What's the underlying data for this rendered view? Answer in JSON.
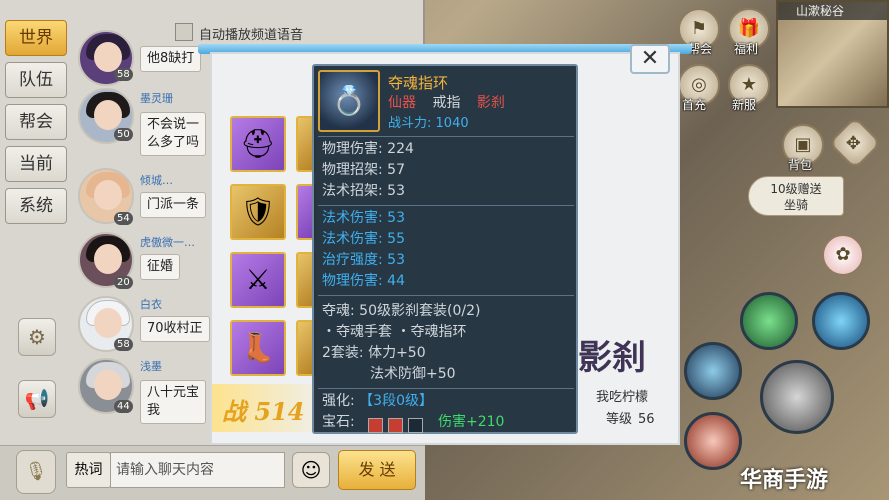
{
  "chat": {
    "tabs": [
      "世界",
      "队伍",
      "帮会",
      "当前",
      "系统"
    ],
    "auto_voice_label": "自动播放频道语音",
    "messages": [
      {
        "name": "",
        "level": "58",
        "text": "他8缺打"
      },
      {
        "name": "墨灵珊",
        "level": "50",
        "text": "不会说一\n么多了吗"
      },
      {
        "name": "倾城…",
        "level": "54",
        "text": "门派一条"
      },
      {
        "name": "虎傲微一…",
        "level": "20",
        "text": "征婚"
      },
      {
        "name": "白衣",
        "level": "58",
        "text": "70收村正"
      },
      {
        "name": "浅墨",
        "level": "44",
        "text": "八十元宝\n我"
      }
    ],
    "hot_label": "热词",
    "input_placeholder": "请输入聊天内容",
    "send_label": "发 送"
  },
  "equip_window": {
    "close_symbol": "✕",
    "power_prefix": "战",
    "power_value": "514",
    "calligraphy": "影刹",
    "player_name": "我吃柠檬",
    "level_label": "等级",
    "level_value": "56"
  },
  "tooltip": {
    "name": "夺魂指环",
    "grade": "仙器",
    "slot_type": "戒指",
    "set_school": "影刹",
    "power_label": "战斗力:",
    "power_value": "1040",
    "base_stats": [
      {
        "label": "物理伤害:",
        "value": "224"
      },
      {
        "label": "物理招架:",
        "value": "57"
      },
      {
        "label": "法术招架:",
        "value": "53"
      }
    ],
    "extra_stats": [
      {
        "label": "法术伤害:",
        "value": "53"
      },
      {
        "label": "法术伤害:",
        "value": "55"
      },
      {
        "label": "治疗强度:",
        "value": "53"
      },
      {
        "label": "物理伤害:",
        "value": "44"
      }
    ],
    "set_title": "夺魂: 50级影刹套装(0/2)",
    "set_items": "・夺魂手套  ・夺魂指环",
    "set_bonus_label": "2套装:",
    "set_bonus_1": "体力+50",
    "set_bonus_2": "法术防御+50",
    "enhance_label": "强化:",
    "enhance_value": "【3段0级】",
    "gem_label": "宝石:",
    "gem_bonus": "伤害+210"
  },
  "hud": {
    "map_title": "山漱秘谷",
    "buttons": [
      "帮会",
      "福利",
      "首充",
      "新服",
      "背包"
    ],
    "promo_line1": "10级赠送",
    "promo_line2": "坐骑",
    "watermark": "华商手游"
  },
  "colors": {
    "accent_gold": "#e2a735",
    "tooltip_bg": "#1c2a38",
    "stat_blue": "#3fb0ef",
    "gem_green": "#3ddb6a",
    "school_red": "#e5534b",
    "item_name_orange": "#f4b33a"
  }
}
